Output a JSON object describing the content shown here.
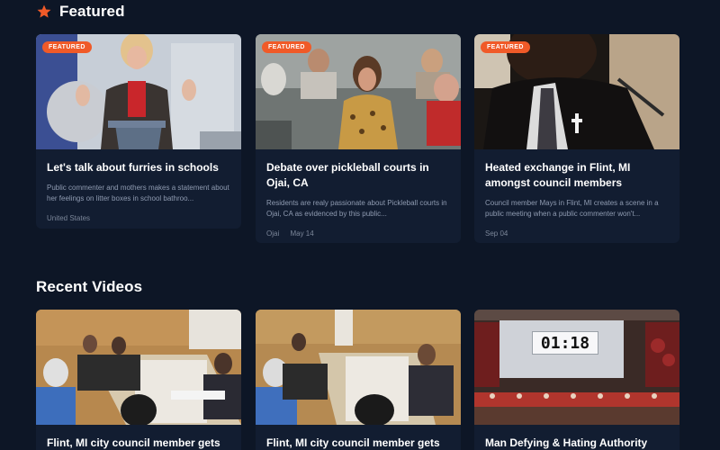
{
  "featured": {
    "title": "Featured",
    "cards": [
      {
        "badge": "FEATURED",
        "title": "Let's talk about furries in schools",
        "description": "Public commenter and mothers makes a statement about her feelings on litter boxes in school bathroo...",
        "meta": [
          "United States"
        ]
      },
      {
        "badge": "FEATURED",
        "title": "Debate over pickleball courts in Ojai, CA",
        "description": "Residents are realy passionate about Pickleball courts in Ojai, CA as evidenced by this public...",
        "meta": [
          "Ojai",
          "May 14"
        ]
      },
      {
        "badge": "FEATURED",
        "title": "Heated exchange in Flint, MI amongst council members",
        "description": "Council member Mays in Flint, MI creates a scene in a public meeting when a public commenter won't...",
        "meta": [
          "Sep 04"
        ]
      }
    ]
  },
  "recent": {
    "title": "Recent Videos",
    "cards": [
      {
        "title": "Flint, MI city council member gets called"
      },
      {
        "title": "Flint, MI city council member gets called"
      },
      {
        "title": "Man Defying & Hating Authority",
        "timer": "01:18"
      }
    ]
  },
  "colors": {
    "background": "#0d1626",
    "card": "#121d31",
    "accent": "#f05a28",
    "muted": "#8f9bb1"
  },
  "icons": {
    "section": "star-icon"
  }
}
